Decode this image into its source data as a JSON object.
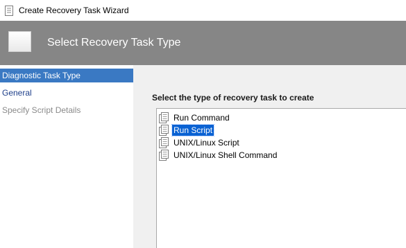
{
  "window": {
    "title": "Create Recovery Task Wizard"
  },
  "header": {
    "title": "Select Recovery Task Type"
  },
  "sidebar": {
    "items": [
      {
        "label": "Diagnostic Task Type",
        "state": "selected"
      },
      {
        "label": "General",
        "state": "link"
      },
      {
        "label": "Specify Script Details",
        "state": "disabled"
      }
    ]
  },
  "main": {
    "section_label": "Select the type of recovery task to create",
    "task_types": [
      {
        "label": "Run Command",
        "selected": false,
        "icon": "script-icon"
      },
      {
        "label": "Run Script",
        "selected": true,
        "icon": "script-icon"
      },
      {
        "label": "UNIX/Linux Script",
        "selected": false,
        "icon": "script-icon"
      },
      {
        "label": "UNIX/Linux Shell Command",
        "selected": false,
        "icon": "script-icon"
      }
    ]
  },
  "colors": {
    "header_bg": "#868686",
    "nav_selected_bg": "#3a79c3",
    "list_selected_bg": "#0a62d3",
    "nav_link": "#1e3f8a",
    "nav_disabled": "#8a8a8a"
  }
}
